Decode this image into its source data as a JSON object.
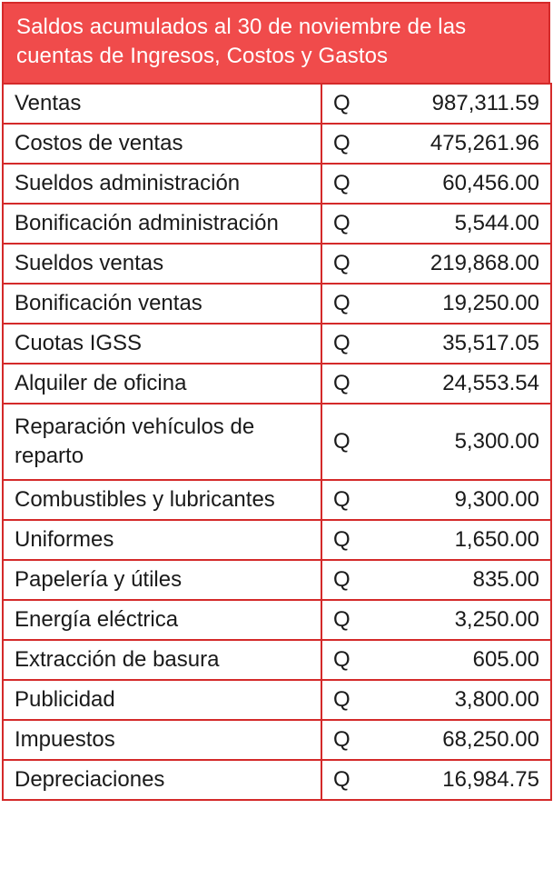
{
  "title": "Saldos acumulados al 30 de noviembre de las cuentas de Ingresos, Costos y Gastos",
  "currency": "Q",
  "colors": {
    "header_bg": "#f04b4b",
    "border": "#d42a2a",
    "header_text": "#ffffff"
  },
  "rows": [
    {
      "label": "Ventas",
      "amount": "987,311.59"
    },
    {
      "label": "Costos de ventas",
      "amount": "475,261.96"
    },
    {
      "label": "Sueldos administración",
      "amount": "60,456.00"
    },
    {
      "label": "Bonificación administración",
      "amount": "5,544.00"
    },
    {
      "label": "Sueldos ventas",
      "amount": "219,868.00"
    },
    {
      "label": "Bonificación ventas",
      "amount": "19,250.00"
    },
    {
      "label": "Cuotas IGSS",
      "amount": "35,517.05"
    },
    {
      "label": "Alquiler de oficina",
      "amount": "24,553.54"
    },
    {
      "label": "Reparación vehículos de reparto",
      "amount": "5,300.00"
    },
    {
      "label": "Combustibles y lubricantes",
      "amount": "9,300.00"
    },
    {
      "label": "Uniformes",
      "amount": "1,650.00"
    },
    {
      "label": "Papelería y útiles",
      "amount": "835.00"
    },
    {
      "label": "Energía eléctrica",
      "amount": "3,250.00"
    },
    {
      "label": "Extracción de basura",
      "amount": "605.00"
    },
    {
      "label": "Publicidad",
      "amount": "3,800.00"
    },
    {
      "label": "Impuestos",
      "amount": "68,250.00"
    },
    {
      "label": "Depreciaciones",
      "amount": "16,984.75"
    }
  ]
}
